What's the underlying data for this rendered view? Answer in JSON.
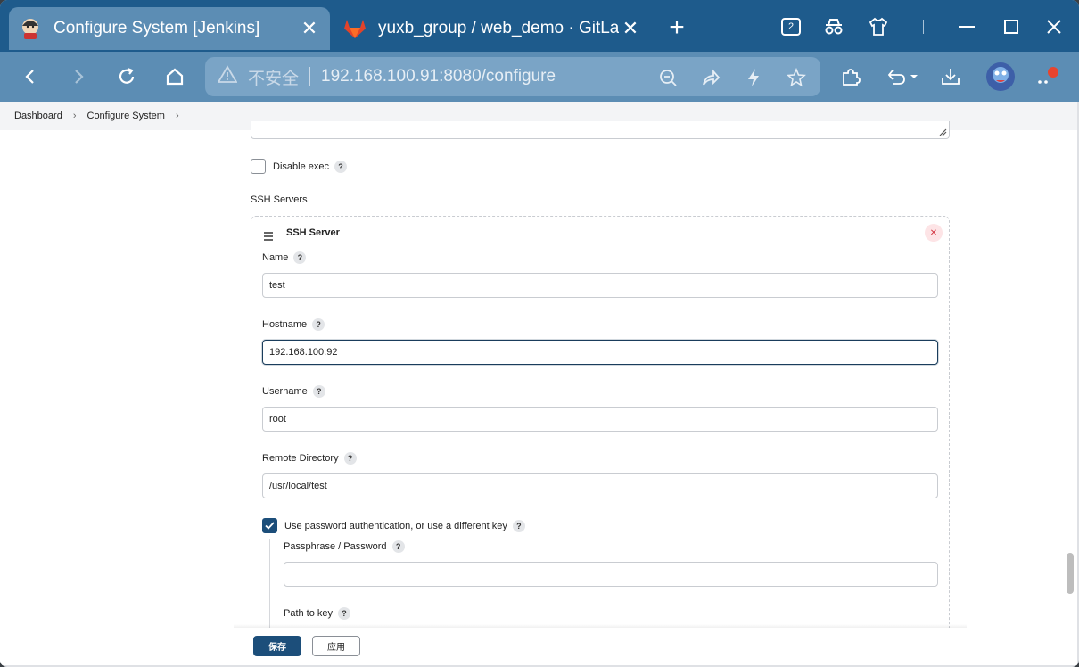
{
  "browser": {
    "active_tab": {
      "title": "Configure System [Jenkins]",
      "close": "✕"
    },
    "inactive_tab": {
      "title": "yuxb_group / web_demo · GitLab",
      "close": "✕"
    },
    "new_tab": "+",
    "tab_count": "2",
    "address": {
      "insecure_label": "不安全",
      "url": "192.168.100.91:8080/configure"
    }
  },
  "breadcrumb": {
    "items": [
      "Dashboard",
      "Configure System"
    ]
  },
  "form": {
    "disable_exec_label": "Disable exec",
    "ssh_servers_label": "SSH Servers",
    "ssh_server_title": "SSH Server",
    "remove": "✕",
    "help": "?",
    "fields": {
      "name": {
        "label": "Name",
        "value": "test"
      },
      "hostname": {
        "label": "Hostname",
        "value": "192.168.100.92"
      },
      "username": {
        "label": "Username",
        "value": "root"
      },
      "remote_directory": {
        "label": "Remote Directory",
        "value": "/usr/local/test"
      },
      "use_password_auth": {
        "label": "Use password authentication, or use a different key",
        "checked": true
      },
      "passphrase": {
        "label": "Passphrase / Password",
        "value": ""
      },
      "path_to_key": {
        "label": "Path to key"
      }
    }
  },
  "buttons": {
    "save": "保存",
    "apply": "应用"
  },
  "colors": {
    "tab_strip": "#1e5b8c",
    "toolbar": "#5c8db4",
    "primary_button": "#1c4e7a",
    "remove_button_bg": "#fde4e6",
    "remove_button_fg": "#d2323f"
  }
}
